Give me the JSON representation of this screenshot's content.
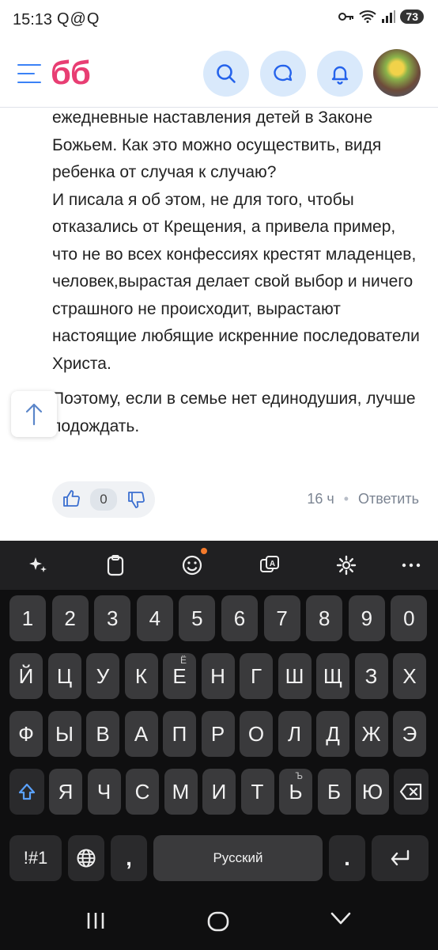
{
  "status_bar": {
    "time": "15:13",
    "notifications": "Q@Q",
    "battery": "73"
  },
  "header": {
    "logo": "бб",
    "icons": [
      "menu-icon",
      "search-icon",
      "chat-icon",
      "bell-icon",
      "avatar"
    ],
    "accent_color": "#3b82f6",
    "logo_color": "#e83e73"
  },
  "comment": {
    "paragraphs": [
      "ежедневные наставления детей в Законе Божьем. Как это можно осуществить, видя ребенка от случая к случаю?",
      "И писала я об этом, не для того, чтобы отказались от Крещения, а привела пример, что не во всех конфессиях крестят младенцев, человек,вырастая делает свой выбор и ничего страшного не происходит, вырастают настоящие любящие искренние последователи Христа.",
      "Поэтому, если в семье нет единодушия, лучше подождать."
    ],
    "votes": "0",
    "time_ago": "16 ч",
    "dot": "•",
    "reply_label": "Ответить"
  },
  "keyboard": {
    "toolbar_icons": [
      "sparkle-icon",
      "clipboard-icon",
      "emoji-icon",
      "translate-icon",
      "settings-icon",
      "more-icon"
    ],
    "rows": [
      [
        "1",
        "2",
        "3",
        "4",
        "5",
        "6",
        "7",
        "8",
        "9",
        "0"
      ],
      [
        "Й",
        "Ц",
        "У",
        "К",
        "Е",
        "Н",
        "Г",
        "Ш",
        "Щ",
        "З",
        "Х"
      ],
      [
        "Ф",
        "Ы",
        "В",
        "А",
        "П",
        "Р",
        "О",
        "Л",
        "Д",
        "Ж",
        "Э"
      ],
      [
        "Я",
        "Ч",
        "С",
        "М",
        "И",
        "Т",
        "Ь",
        "Б",
        "Ю"
      ]
    ],
    "hint_e": "Ё",
    "hint_soft": "Ъ",
    "symbols_label": "!#1",
    "comma_label": ",",
    "space_label": "Русский",
    "period_label": ".",
    "nav_icons": [
      "recent-apps-icon",
      "home-icon",
      "back-icon"
    ]
  }
}
